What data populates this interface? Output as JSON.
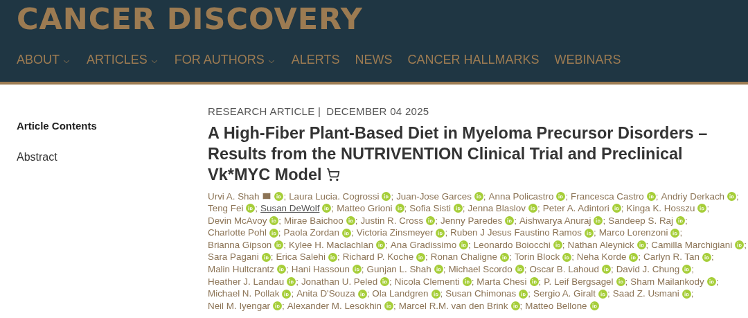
{
  "header": {
    "logo": "CANCER DISCOVERY",
    "nav": [
      {
        "label": "ABOUT",
        "dropdown": true
      },
      {
        "label": "ARTICLES",
        "dropdown": true
      },
      {
        "label": "FOR AUTHORS",
        "dropdown": true
      },
      {
        "label": "ALERTS",
        "dropdown": false
      },
      {
        "label": "NEWS",
        "dropdown": false
      },
      {
        "label": "CANCER HALLMARKS",
        "dropdown": false
      },
      {
        "label": "WEBINARS",
        "dropdown": false
      }
    ]
  },
  "sidebar": {
    "items": [
      {
        "label": "Article Contents",
        "selected": true
      },
      {
        "label": "Abstract",
        "selected": false
      }
    ]
  },
  "article": {
    "type": "RESEARCH ARTICLE",
    "type_separator": "|",
    "date": "DECEMBER 04 2025",
    "title_lines": [
      "A High-Fiber Plant-Based Diet in Myeloma Precursor Disorders –",
      "Results from the NUTRIVENTION Clinical Trial and Preclinical",
      "Vk*MYC Model"
    ],
    "cart": true,
    "separator": ";",
    "author_lines": [
      [
        {
          "name": "Urvi A. Shah",
          "email": true,
          "orcid": true,
          "link": false
        },
        {
          "name": "Laura Lucia. Cogrossi",
          "email": false,
          "orcid": true,
          "link": false
        },
        {
          "name": "Juan-Jose Garces",
          "email": false,
          "orcid": true,
          "link": false
        },
        {
          "name": "Anna Policastro",
          "email": false,
          "orcid": true,
          "link": false
        },
        {
          "name": "Francesca Castro",
          "email": false,
          "orcid": true,
          "link": false
        },
        {
          "name": "Andriy Derkach",
          "email": false,
          "orcid": true,
          "link": false
        }
      ],
      [
        {
          "name": "Teng Fei",
          "email": false,
          "orcid": true,
          "link": false
        },
        {
          "name": "Susan DeWolf",
          "email": false,
          "orcid": true,
          "link": true
        },
        {
          "name": "Matteo Grioni",
          "email": false,
          "orcid": true,
          "link": false
        },
        {
          "name": "Sofia Sisti",
          "email": false,
          "orcid": true,
          "link": false
        },
        {
          "name": "Jenna Blaslov",
          "email": false,
          "orcid": true,
          "link": false
        },
        {
          "name": "Peter A. Adintori",
          "email": false,
          "orcid": true,
          "link": false
        },
        {
          "name": "Kinga K. Hosszu",
          "email": false,
          "orcid": true,
          "link": false
        }
      ],
      [
        {
          "name": "Devin McAvoy",
          "email": false,
          "orcid": true,
          "link": false
        },
        {
          "name": "Mirae Baichoo",
          "email": false,
          "orcid": true,
          "link": false
        },
        {
          "name": "Justin R. Cross",
          "email": false,
          "orcid": true,
          "link": false
        },
        {
          "name": "Jenny Paredes",
          "email": false,
          "orcid": true,
          "link": false
        },
        {
          "name": "Aishwarya Anuraj",
          "email": false,
          "orcid": true,
          "link": false
        },
        {
          "name": "Sandeep S. Raj",
          "email": false,
          "orcid": true,
          "link": false
        }
      ],
      [
        {
          "name": "Charlotte Pohl",
          "email": false,
          "orcid": true,
          "link": false
        },
        {
          "name": "Paola Zordan",
          "email": false,
          "orcid": true,
          "link": false
        },
        {
          "name": "Victoria Zinsmeyer",
          "email": false,
          "orcid": true,
          "link": false
        },
        {
          "name": "Ruben J Jesus Faustino Ramos",
          "email": false,
          "orcid": true,
          "link": false
        },
        {
          "name": "Marco Lorenzoni",
          "email": false,
          "orcid": true,
          "link": false
        }
      ],
      [
        {
          "name": "Brianna Gipson",
          "email": false,
          "orcid": true,
          "link": false
        },
        {
          "name": "Kylee H. Maclachlan",
          "email": false,
          "orcid": true,
          "link": false
        },
        {
          "name": "Ana Gradissimo",
          "email": false,
          "orcid": true,
          "link": false
        },
        {
          "name": "Leonardo Boiocchi",
          "email": false,
          "orcid": true,
          "link": false
        },
        {
          "name": "Nathan Aleynick",
          "email": false,
          "orcid": true,
          "link": false
        },
        {
          "name": "Camilla Marchigiani",
          "email": false,
          "orcid": true,
          "link": false
        }
      ],
      [
        {
          "name": "Sara Pagani",
          "email": false,
          "orcid": true,
          "link": false
        },
        {
          "name": "Erica Salehi",
          "email": false,
          "orcid": true,
          "link": false
        },
        {
          "name": "Richard P. Koche",
          "email": false,
          "orcid": true,
          "link": false
        },
        {
          "name": "Ronan Chaligne",
          "email": false,
          "orcid": true,
          "link": false
        },
        {
          "name": "Torin Block",
          "email": false,
          "orcid": true,
          "link": false
        },
        {
          "name": "Neha Korde",
          "email": false,
          "orcid": true,
          "link": false
        },
        {
          "name": "Carlyn R. Tan",
          "email": false,
          "orcid": true,
          "link": false
        }
      ],
      [
        {
          "name": "Malin Hultcrantz",
          "email": false,
          "orcid": true,
          "link": false
        },
        {
          "name": "Hani Hassoun",
          "email": false,
          "orcid": true,
          "link": false
        },
        {
          "name": "Gunjan L. Shah",
          "email": false,
          "orcid": true,
          "link": false
        },
        {
          "name": "Michael Scordo",
          "email": false,
          "orcid": true,
          "link": false
        },
        {
          "name": "Oscar B. Lahoud",
          "email": false,
          "orcid": true,
          "link": false
        },
        {
          "name": "David J. Chung",
          "email": false,
          "orcid": true,
          "link": false
        }
      ],
      [
        {
          "name": "Heather J. Landau",
          "email": false,
          "orcid": true,
          "link": false
        },
        {
          "name": "Jonathan U. Peled",
          "email": false,
          "orcid": true,
          "link": false
        },
        {
          "name": "Nicola Clementi",
          "email": false,
          "orcid": true,
          "link": false
        },
        {
          "name": "Marta Chesi",
          "email": false,
          "orcid": true,
          "link": false
        },
        {
          "name": "P. Leif Bergsagel",
          "email": false,
          "orcid": true,
          "link": false
        },
        {
          "name": "Sham Mailankody",
          "email": false,
          "orcid": true,
          "link": false
        }
      ],
      [
        {
          "name": "Michael N. Pollak",
          "email": false,
          "orcid": true,
          "link": false
        },
        {
          "name": "Anita D'Souza",
          "email": false,
          "orcid": true,
          "link": false
        },
        {
          "name": "Ola Landgren",
          "email": false,
          "orcid": true,
          "link": false
        },
        {
          "name": "Susan Chimonas",
          "email": false,
          "orcid": true,
          "link": false
        },
        {
          "name": "Sergio A. Giralt",
          "email": false,
          "orcid": true,
          "link": false
        },
        {
          "name": "Saad Z. Usmani",
          "email": false,
          "orcid": true,
          "link": false
        }
      ],
      [
        {
          "name": "Neil M. Iyengar",
          "email": false,
          "orcid": true,
          "link": false
        },
        {
          "name": "Alexander M. Lesokhin",
          "email": false,
          "orcid": true,
          "link": false
        },
        {
          "name": "Marcel R.M. van den Brink",
          "email": false,
          "orcid": true,
          "link": false
        },
        {
          "name": "Matteo Bellone",
          "email": false,
          "orcid": true,
          "link": false
        }
      ]
    ]
  }
}
